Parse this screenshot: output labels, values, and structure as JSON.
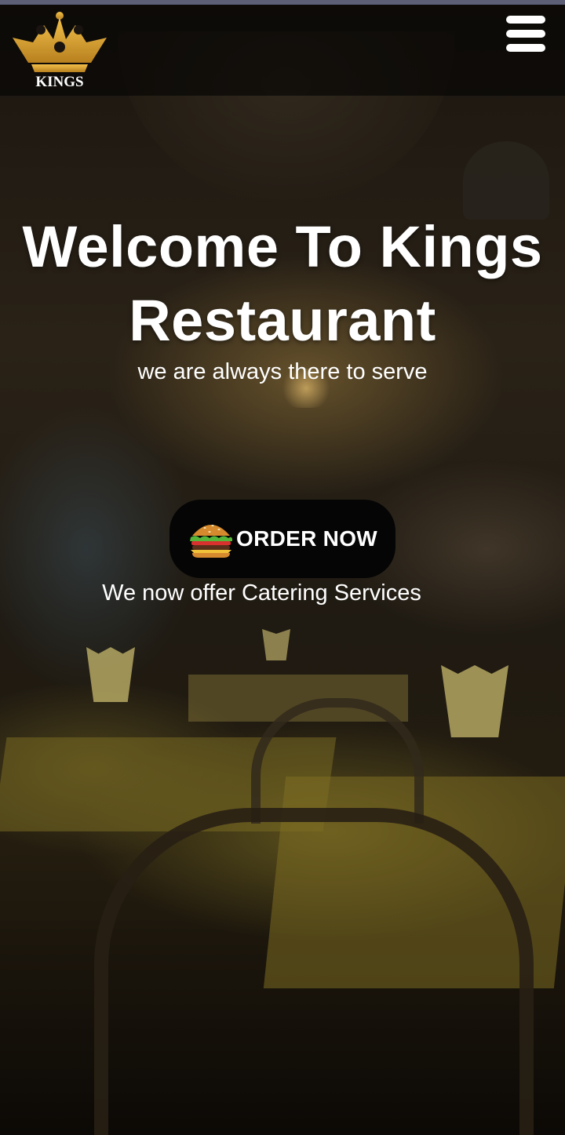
{
  "header": {
    "logo_text": "KINGS",
    "logo_icon": "crown-icon",
    "menu_icon": "hamburger-menu-icon"
  },
  "hero": {
    "title_line1": "Welcome To Kings",
    "title_line2": "Restaurant",
    "subtitle": "we are always there to serve",
    "order_button": {
      "icon": "burger-icon",
      "label": "ORDER NOW"
    },
    "catering_text": "We now offer Catering Services"
  },
  "colors": {
    "header_bg": "#080706",
    "top_edge": "#5c5f76",
    "logo_gold": "#d9a534",
    "button_bg": "#050505",
    "text": "#ffffff"
  }
}
